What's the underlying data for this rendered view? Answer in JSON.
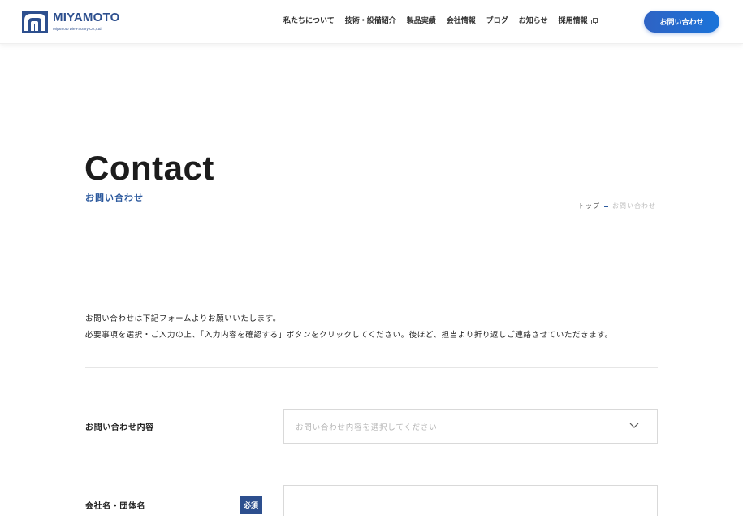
{
  "header": {
    "logo": {
      "name": "MIYAMOTO",
      "subtitle": "Miyamoto Die Factory Co.,Ltd."
    },
    "nav": [
      {
        "label": "私たちについて"
      },
      {
        "label": "技術・設備紹介"
      },
      {
        "label": "製品実績"
      },
      {
        "label": "会社情報"
      },
      {
        "label": "ブログ"
      },
      {
        "label": "お知らせ"
      },
      {
        "label": "採用情報"
      }
    ],
    "cta": "お問い合わせ"
  },
  "hero": {
    "title": "Contact",
    "subtitle": "お問い合わせ"
  },
  "breadcrumb": {
    "home": "トップ",
    "current": "お問い合わせ"
  },
  "intro": {
    "line1": "お問い合わせは下記フォームよりお願いいたします。",
    "line2": "必要事項を選択・ご入力の上、「入力内容を確認する」ボタンをクリックしてください。後ほど、担当より折り返しご連絡させていただきます。"
  },
  "form": {
    "inquiry": {
      "label": "お問い合わせ内容",
      "placeholder": "お問い合わせ内容を選択してください"
    },
    "company": {
      "label": "会社名・団体名",
      "required": "必須",
      "value": ""
    }
  },
  "colors": {
    "brand": "#2d4f8e",
    "accent": "#1a73d9",
    "subtitle": "#2d5a9e"
  },
  "icons": {
    "external": "external-link-icon",
    "select": "chevron-down-icon"
  }
}
